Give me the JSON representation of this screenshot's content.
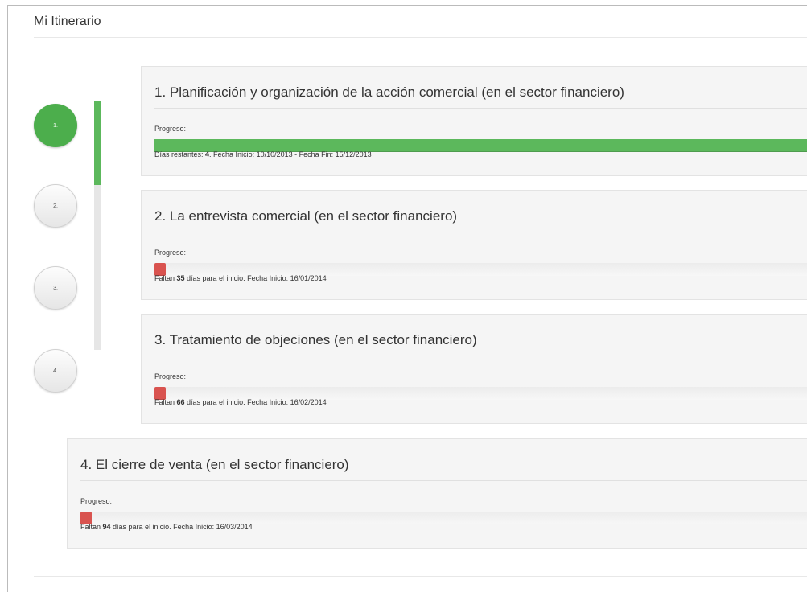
{
  "page_title": "Mi Itinerario",
  "progress_label": "Progreso:",
  "colors": {
    "done": "#5cb85c",
    "pending": "#d9534f"
  },
  "timeline": {
    "progress_fraction": 0.34
  },
  "steps": [
    {
      "number": "1.",
      "status": "done",
      "title": "1. Planificación y organización de la acción comercial (en el sector financiero)",
      "progress_fraction": 1.0,
      "text_prefix": "Días restantes: ",
      "text_bold": "4",
      "text_suffix": ". Fecha Inicio: 10/10/2013 - Fecha Fin: 15/12/2013"
    },
    {
      "number": "2.",
      "status": "pending",
      "title": "2. La entrevista comercial (en el sector financiero)",
      "progress_fraction": 0.0,
      "text_prefix": "Faltan ",
      "text_bold": "35",
      "text_suffix": " días para el inicio. Fecha Inicio: 16/01/2014"
    },
    {
      "number": "3.",
      "status": "pending",
      "title": "3. Tratamiento de objeciones (en el sector financiero)",
      "progress_fraction": 0.0,
      "text_prefix": "Faltan ",
      "text_bold": "66",
      "text_suffix": " días para el inicio. Fecha Inicio: 16/02/2014"
    },
    {
      "number": "4.",
      "status": "pending",
      "title": "4. El cierre de venta (en el sector financiero)",
      "progress_fraction": 0.0,
      "text_prefix": "Faltan ",
      "text_bold": "94",
      "text_suffix": " días para el inicio. Fecha Inicio: 16/03/2014"
    }
  ]
}
